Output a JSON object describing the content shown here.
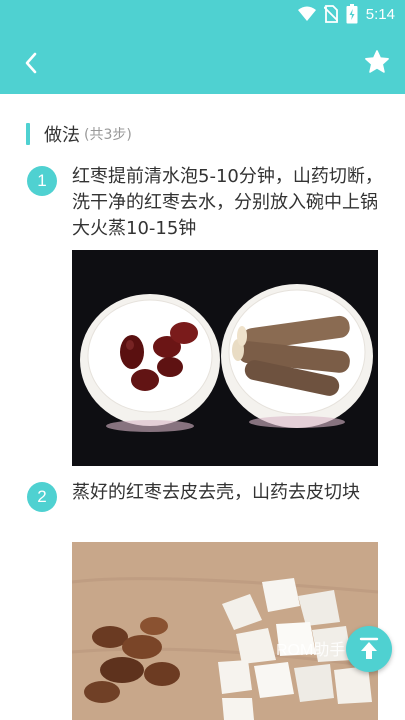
{
  "status_bar": {
    "time": "5:14"
  },
  "app_bar": {
    "back_icon": "chevron-left-icon",
    "favorite_icon": "star-icon"
  },
  "section": {
    "title": "做法",
    "count": "(共3步)"
  },
  "steps": [
    {
      "num": "1",
      "text": "红枣提前清水泡5-10分钟，山药切断，洗干净的红枣去水，分别放入碗中上锅大火蒸10-15钟"
    },
    {
      "num": "2",
      "text": "蒸好的红枣去皮去壳，山药去皮切块"
    }
  ],
  "watermark": "ROM助手",
  "colors": {
    "accent": "#4fd1d1"
  }
}
